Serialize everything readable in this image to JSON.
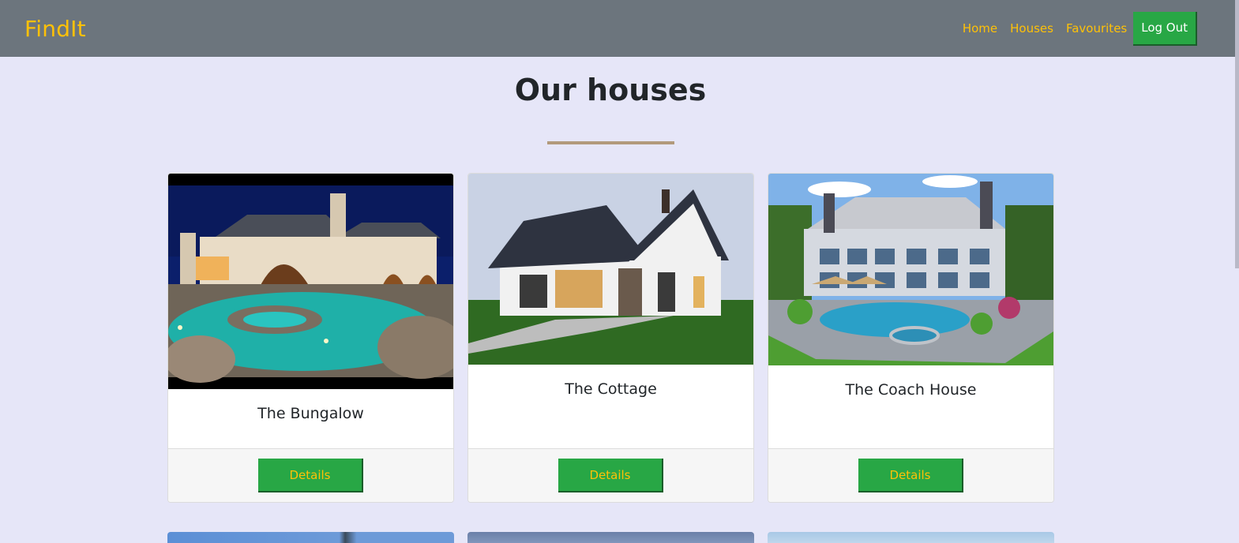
{
  "navbar": {
    "brand": "FindIt",
    "links": [
      "Home",
      "Houses",
      "Favourites"
    ],
    "logout_label": "Log Out"
  },
  "page": {
    "title": "Our houses"
  },
  "houses": [
    {
      "name": "The Bungalow",
      "details_label": "Details"
    },
    {
      "name": "The Cottage",
      "details_label": "Details"
    },
    {
      "name": "The Coach House",
      "details_label": "Details"
    }
  ],
  "colors": {
    "navbar_bg": "#6c757d",
    "brand": "#ffc107",
    "button_green": "#28a745",
    "page_bg": "#e6e6f8",
    "title_rule": "#b29a7c"
  }
}
